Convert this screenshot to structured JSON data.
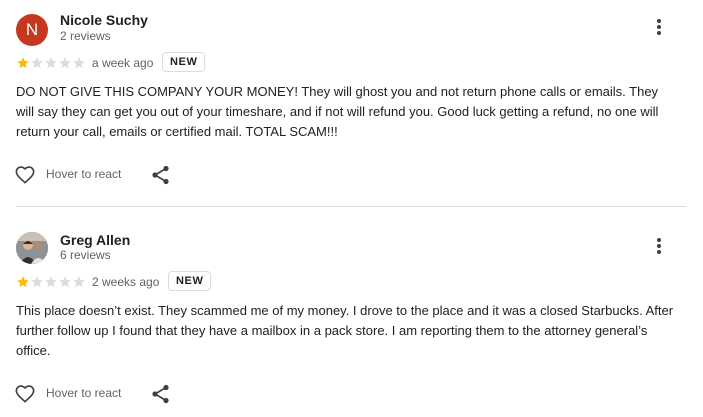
{
  "reviews": [
    {
      "author": "Nicole Suchy",
      "review_count": "2 reviews",
      "avatar_letter": "N",
      "rating": 1,
      "max_rating": 5,
      "time": "a week ago",
      "badge": "NEW",
      "text": "DO NOT GIVE THIS COMPANY YOUR MONEY! They will ghost you and not return phone calls or emails. They will say they can get you out of your timeshare, and if not will refund you. Good luck getting a refund, no one will return your call, emails or certified mail. TOTAL SCAM!!!",
      "react_label": "Hover to react"
    },
    {
      "author": "Greg Allen",
      "review_count": "6 reviews",
      "rating": 1,
      "max_rating": 5,
      "time": "2 weeks ago",
      "badge": "NEW",
      "text": "This place doesn’t exist. They scammed me of my money. I drove to the place and it was a closed Starbucks. After further follow up I found that they have a mailbox in a pack store. I am reporting them to the attorney general’s office.",
      "react_label": "Hover to react"
    }
  ],
  "colors": {
    "star_filled": "#fbbc04",
    "star_empty": "#dadce0",
    "avatar_n": "#c5371f"
  }
}
